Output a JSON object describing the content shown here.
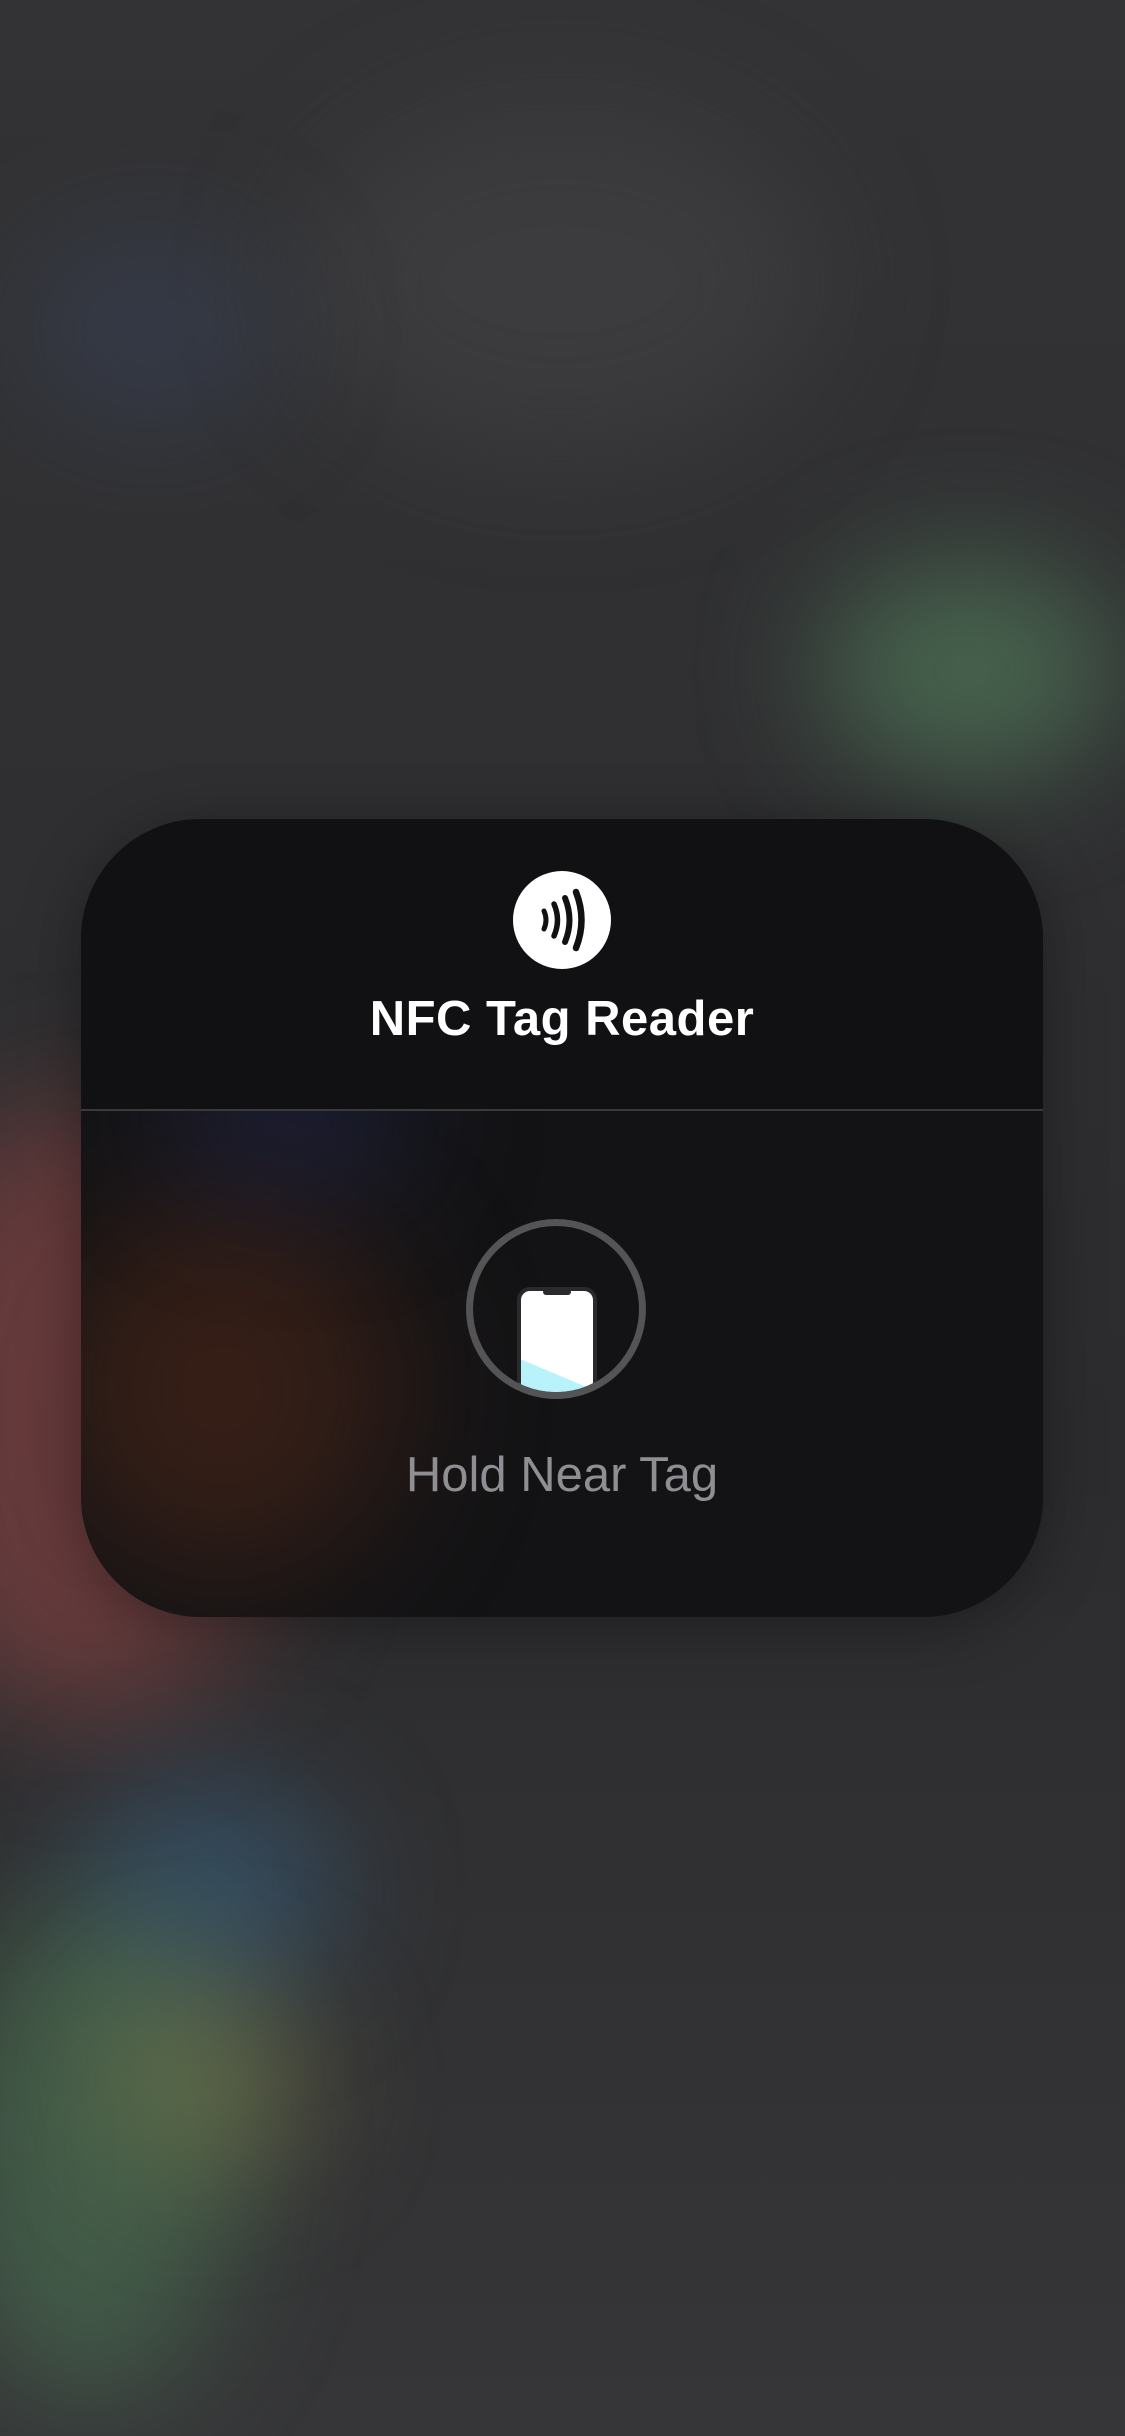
{
  "nfc_sheet": {
    "title": "NFC Tag Reader",
    "status_text": "Hold Near Tag",
    "header_icon": "nfc-contactless-icon",
    "scan_icon": "phone-scan-icon"
  },
  "colors": {
    "sheet_background": "#131315",
    "title_text": "#ffffff",
    "status_text": "#8e8e93",
    "scan_wave": "#b8f2fb"
  }
}
